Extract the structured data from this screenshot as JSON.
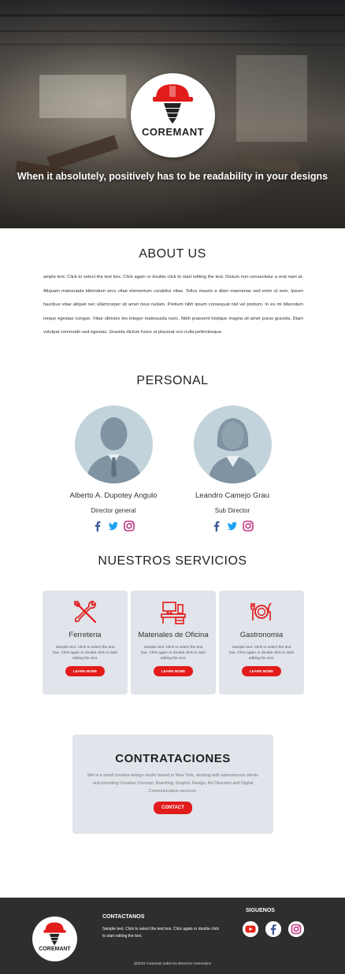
{
  "hero": {
    "logo_text": "COREMANT",
    "title": "When it absolutely, positively has to be readability in your designs"
  },
  "about": {
    "heading": "ABOUT US",
    "body": "ample text. Click to select the text box. Click again or double click to start editing the text. Dictum non consectetur a erat nam at. Aliquam malesuada bibendum arcu vitae elementum curabitur vitae. Tellus mauris a diam maecenas sed enim ut sem. Ipsum faucibus vitae aliquet nec ullamcorper sit amet risus nullam. Pretium nibh ipsum consequat nisl vel pretium. In eu mi bibendum neque egestas congue. Vitae ultricies leo integer malesuada nunc. Nibh praesent tristique magna sit amet purus gravida. Diam volutpat commodo sed egestas. Gravida dictum fusce ut placerat orci nulla pellentesque."
  },
  "personal": {
    "heading": "PERSONAL",
    "people": [
      {
        "name": "Alberto A. Dupotey Angulo",
        "role": "Director general"
      },
      {
        "name": "Leandro Camejo Grau",
        "role": "Sub Director"
      }
    ]
  },
  "services": {
    "heading": "NUESTROS SERVICIOS",
    "items": [
      {
        "icon": "tools-icon",
        "title": "Ferreteria",
        "text": "Sample text. Click to select the text box. Click again or double click to start editing the text.",
        "button": "LEARN MORE"
      },
      {
        "icon": "office-desk-icon",
        "title": "Materiales de Oficina",
        "text": "Sample text. Click to select the text box. Click again or double click to start editing the text.",
        "button": "LEARN MORE"
      },
      {
        "icon": "dining-icon",
        "title": "Gastronomia",
        "text": "Sample text. Click to select the text box. Click again or double click to start editing the text.",
        "button": "LEARN MORE"
      }
    ]
  },
  "contract": {
    "heading": "CONTRATACIONES",
    "text": "We're a small creative design studio based in New York, working with adventurous clients and providing Creative Concept, Branding, Graphic Design, Art Direction and Digital Communication services.",
    "button": "CONTACT"
  },
  "footer": {
    "logo_text": "COREMANT",
    "contact_heading": "CONTACTANOS",
    "contact_text": "Sample text. Click to select the text box. Click again or double click to start editing the text.",
    "social_heading": "SIGUENOS",
    "copyright": "@2023 Coremant todos los derechos reservados"
  },
  "colors": {
    "accent": "#e21b1b",
    "card_bg": "#e1e4ea",
    "footer_bg": "#2e2e2e",
    "avatar_bg": "#c2d3dc",
    "facebook": "#3b5998",
    "twitter": "#1da1f2",
    "instagram": "#c13584",
    "youtube": "#e62117"
  }
}
